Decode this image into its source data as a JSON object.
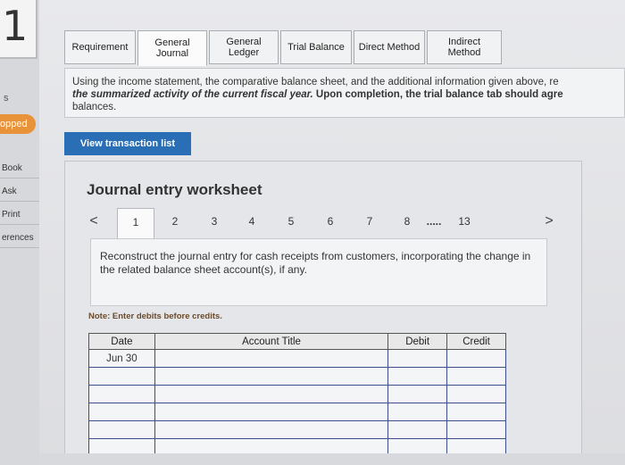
{
  "question_number": "1",
  "sidebar": {
    "fragment_s": "s",
    "badge": "opped",
    "links": [
      "Book",
      "Ask",
      "Print",
      "erences"
    ]
  },
  "tabs": [
    {
      "label": "Requirement",
      "active": false
    },
    {
      "label": "General Journal",
      "active": true
    },
    {
      "label": "General Ledger",
      "active": false
    },
    {
      "label": "Trial Balance",
      "active": false
    },
    {
      "label": "Direct Method",
      "active": false
    },
    {
      "label": "Indirect Method",
      "active": false
    }
  ],
  "instructions": {
    "part1": "Using the income statement, the comparative balance sheet, and the additional information given above, re",
    "part2_bi": "the summarized activity of the current fiscal year.",
    "part3_b": " Upon completion, the trial balance tab should agre",
    "part4": "balances."
  },
  "view_transactions_label": "View transaction list",
  "worksheet": {
    "title": "Journal entry worksheet",
    "prev_arrow": "<",
    "next_arrow": ">",
    "pages": [
      "1",
      "2",
      "3",
      "4",
      "5",
      "6",
      "7",
      "8",
      ".....",
      "13"
    ],
    "active_page": "1",
    "description": "Reconstruct the journal entry for cash receipts from customers, incorporating the change in the related balance sheet account(s), if any.",
    "note_label": "Note:",
    "note_text": " Enter debits before credits.",
    "table": {
      "headers": [
        "Date",
        "Account Title",
        "Debit",
        "Credit"
      ],
      "rows": [
        [
          "Jun 30",
          "",
          "",
          ""
        ],
        [
          "",
          "",
          "",
          ""
        ],
        [
          "",
          "",
          "",
          ""
        ],
        [
          "",
          "",
          "",
          ""
        ],
        [
          "",
          "",
          "",
          ""
        ],
        [
          "",
          "",
          "",
          ""
        ]
      ]
    }
  },
  "colors": {
    "accent_blue": "#2a6fb5",
    "badge_orange": "#e8923a",
    "table_border": "#3b4f8a"
  }
}
